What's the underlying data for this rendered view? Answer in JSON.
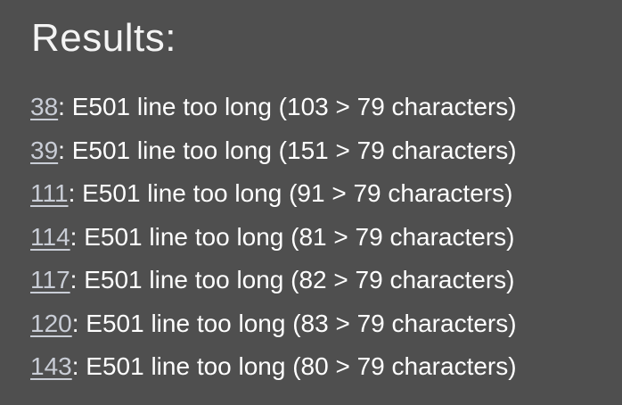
{
  "title": "Results:",
  "results": [
    {
      "line": "38",
      "message": ": E501 line too long (103 > 79 characters)"
    },
    {
      "line": "39",
      "message": ": E501 line too long (151 > 79 characters)"
    },
    {
      "line": "111",
      "message": ": E501 line too long (91 > 79 characters)"
    },
    {
      "line": "114",
      "message": ": E501 line too long (81 > 79 characters)"
    },
    {
      "line": "117",
      "message": ": E501 line too long (82 > 79 characters)"
    },
    {
      "line": "120",
      "message": ": E501 line too long (83 > 79 characters)"
    },
    {
      "line": "143",
      "message": ": E501 line too long (80 > 79 characters)"
    }
  ]
}
